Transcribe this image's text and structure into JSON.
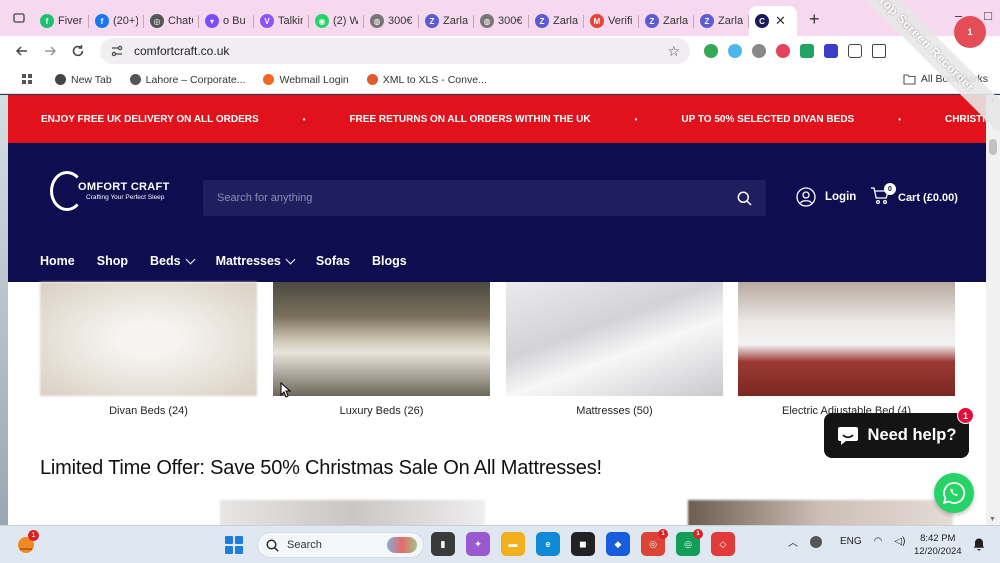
{
  "browser": {
    "tabs": [
      {
        "title": "Fiverr",
        "icon": "fiverr-icon",
        "color": "#1dbf73",
        "glyph": "f"
      },
      {
        "title": "(20+)",
        "icon": "facebook-icon",
        "color": "#1877f2",
        "glyph": "f"
      },
      {
        "title": "ChatGPT",
        "icon": "chatgpt-icon",
        "color": "#555555",
        "glyph": "◎"
      },
      {
        "title": "o Bu",
        "icon": "chat-bubble-icon",
        "color": "#7c4dff",
        "glyph": "▾"
      },
      {
        "title": "Talkin",
        "icon": "talkin-icon",
        "color": "#8c52ff",
        "glyph": "V"
      },
      {
        "title": "(2) W",
        "icon": "whatsapp-icon",
        "color": "#25d366",
        "glyph": "◉"
      },
      {
        "title": "300€",
        "icon": "globe-icon",
        "color": "#777777",
        "glyph": "◍"
      },
      {
        "title": "Zarla",
        "icon": "zarla-icon",
        "color": "#5b5bd6",
        "glyph": "Z"
      },
      {
        "title": "300€",
        "icon": "globe-icon",
        "color": "#777777",
        "glyph": "◍"
      },
      {
        "title": "Zarla",
        "icon": "zarla-icon",
        "color": "#5b5bd6",
        "glyph": "Z"
      },
      {
        "title": "Verifi",
        "icon": "gmail-icon",
        "color": "#ea4335",
        "glyph": "M"
      },
      {
        "title": "Zarla",
        "icon": "zarla-icon",
        "color": "#5b5bd6",
        "glyph": "Z"
      },
      {
        "title": "Zarla",
        "icon": "zarla-icon",
        "color": "#5b5bd6",
        "glyph": "Z"
      }
    ],
    "active_tab_icon_color": "#1b1a5e",
    "close_symbol": "✕",
    "new_tab_symbol": "+",
    "window_minimize": "–",
    "window_maximize": "□",
    "url": "comfortcraft.co.uk",
    "recorder_text": "iTop Screen Recorder",
    "recorder_badge": "1",
    "bookmarks": [
      {
        "label": "New Tab",
        "color": "#444444"
      },
      {
        "label": "Lahore – Corporate...",
        "color": "#555555"
      },
      {
        "label": "Webmail Login",
        "color": "#f26522"
      },
      {
        "label": "XML to XLS - Conve...",
        "color": "#e05a2b"
      }
    ],
    "all_bookmarks": "All Bookmarks"
  },
  "site": {
    "announcements": [
      "ENJOY FREE UK DELIVERY ON ALL ORDERS",
      "FREE RETURNS ON ALL ORDERS WITHIN THE UK",
      "UP TO 50% SELECTED DIVAN BEDS",
      "CHRISTMAS SA"
    ],
    "announce_separator": "•",
    "brand_color": "#0e0d4f",
    "announce_color": "#e1121c",
    "logo_name": "OMFORT CRAFT",
    "logo_tagline": "Crafting Your Perfect Sleep",
    "search_placeholder": "Search for anything",
    "login_label": "Login",
    "cart_label": "Cart (£0.00)",
    "cart_count": "0",
    "nav": [
      {
        "label": "Home",
        "dropdown": false
      },
      {
        "label": "Shop",
        "dropdown": false
      },
      {
        "label": "Beds",
        "dropdown": true
      },
      {
        "label": "Mattresses",
        "dropdown": true
      },
      {
        "label": "Sofas",
        "dropdown": false
      },
      {
        "label": "Blogs",
        "dropdown": false
      }
    ],
    "categories": [
      {
        "label": "Divan Beds (24)"
      },
      {
        "label": "Luxury Beds (26)"
      },
      {
        "label": "Mattresses (50)"
      },
      {
        "label": "Electric Adjustable Bed (4)"
      }
    ],
    "offer_title": "Limited Time Offer: Save 50% Christmas Sale On All Mattresses!",
    "help_label": "Need help?",
    "help_badge": "1"
  },
  "taskbar": {
    "weather_badge": "1",
    "search_label": "Search",
    "apps": [
      {
        "name": "file-manager-icon",
        "color": "#3a3a3a",
        "glyph": "▮",
        "badge": ""
      },
      {
        "name": "copilot-icon",
        "color": "#9b59d0",
        "glyph": "✦",
        "badge": ""
      },
      {
        "name": "file-explorer-icon",
        "color": "#f2b01e",
        "glyph": "▬",
        "badge": ""
      },
      {
        "name": "edge-icon",
        "color": "#0f8ad6",
        "glyph": "e",
        "badge": ""
      },
      {
        "name": "screen-recorder-icon",
        "color": "#222222",
        "glyph": "◼",
        "badge": ""
      },
      {
        "name": "bitwarden-icon",
        "color": "#175ddc",
        "glyph": "◆",
        "badge": ""
      },
      {
        "name": "chrome-icon",
        "color": "#db4437",
        "glyph": "◎",
        "badge": "1"
      },
      {
        "name": "chrome-profile-icon",
        "color": "#0f9d58",
        "glyph": "◎",
        "badge": "1"
      },
      {
        "name": "anydesk-icon",
        "color": "#e23a3a",
        "glyph": "◇",
        "badge": ""
      }
    ],
    "language": "ENG",
    "time": "8:42 PM",
    "date": "12/20/2024"
  }
}
